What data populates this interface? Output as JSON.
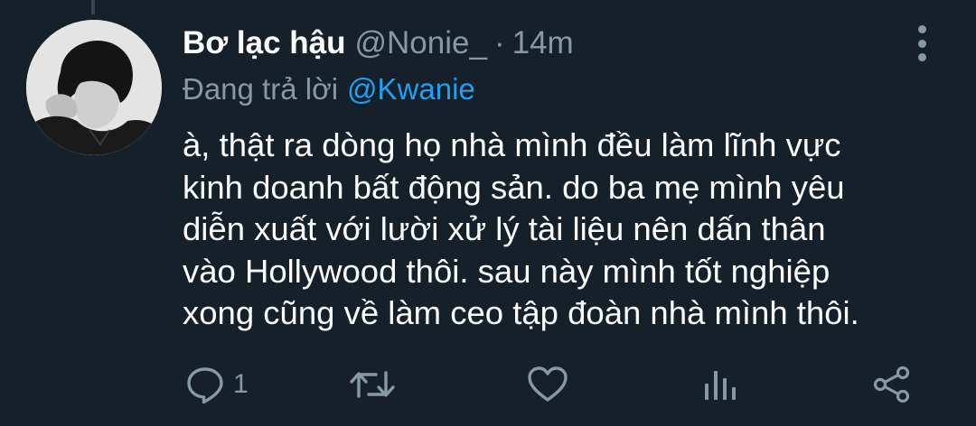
{
  "tweet": {
    "display_name": "Bơ lạc hậu",
    "handle": "@Nonie_",
    "separator": "·",
    "time": "14m",
    "reply_prefix": "Đang trả lời",
    "reply_to": "@Kwanie",
    "body_lines": [
      "à, thật ra dòng họ nhà mình đều làm lĩnh vực",
      "kinh doanh bất động sản. do ba mẹ mình yêu",
      "diễn xuất với lười xử lý tài liệu nên dấn thân",
      "vào Hollywood thôi. sau này mình tốt nghiệp",
      "xong cũng về làm ceo tập đoàn nhà mình thôi."
    ]
  },
  "actions": {
    "reply_count": "1",
    "retweet_count": "",
    "like_count": "",
    "icons": [
      "reply-icon",
      "retweet-icon",
      "like-icon",
      "analytics-icon",
      "share-icon"
    ]
  },
  "colors": {
    "background": "#15202b",
    "primary_text": "#ffffff",
    "secondary_text": "#8899a6",
    "accent": "#1da1f2",
    "thread_line": "#38444d"
  }
}
